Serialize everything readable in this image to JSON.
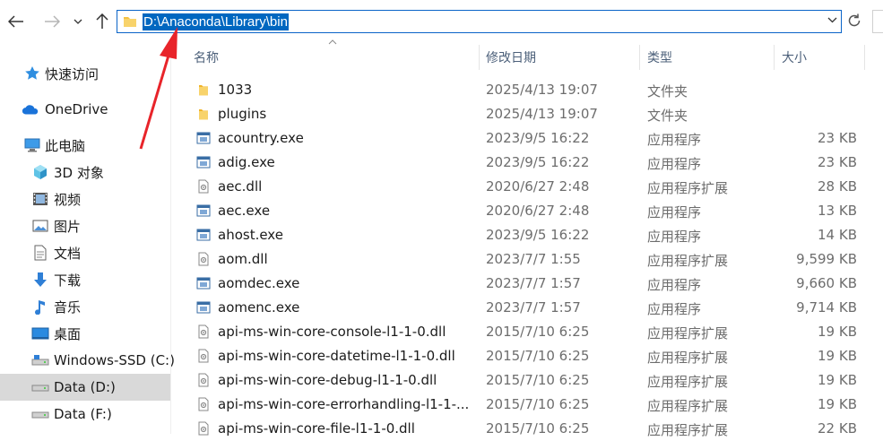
{
  "address": {
    "path": "D:\\Anaconda\\Library\\bin"
  },
  "columns": {
    "name": "名称",
    "date": "修改日期",
    "type": "类型",
    "size": "大小"
  },
  "sidebar": {
    "items": [
      {
        "label": "快速访问"
      },
      {
        "label": "OneDrive"
      },
      {
        "label": "此电脑"
      },
      {
        "label": "3D 对象"
      },
      {
        "label": "视频"
      },
      {
        "label": "图片"
      },
      {
        "label": "文档"
      },
      {
        "label": "下载"
      },
      {
        "label": "音乐"
      },
      {
        "label": "桌面"
      },
      {
        "label": "Windows-SSD (C:)"
      },
      {
        "label": "Data (D:)"
      },
      {
        "label": "Data (F:)"
      }
    ]
  },
  "files": [
    {
      "name": "1033",
      "date": "2025/4/13 19:07",
      "type": "文件夹",
      "size": "",
      "icon": "folder"
    },
    {
      "name": "plugins",
      "date": "2025/4/13 19:07",
      "type": "文件夹",
      "size": "",
      "icon": "folder"
    },
    {
      "name": "acountry.exe",
      "date": "2023/9/5 16:22",
      "type": "应用程序",
      "size": "23 KB",
      "icon": "exe"
    },
    {
      "name": "adig.exe",
      "date": "2023/9/5 16:22",
      "type": "应用程序",
      "size": "23 KB",
      "icon": "exe"
    },
    {
      "name": "aec.dll",
      "date": "2020/6/27 2:48",
      "type": "应用程序扩展",
      "size": "28 KB",
      "icon": "dll"
    },
    {
      "name": "aec.exe",
      "date": "2020/6/27 2:48",
      "type": "应用程序",
      "size": "13 KB",
      "icon": "exe"
    },
    {
      "name": "ahost.exe",
      "date": "2023/9/5 16:22",
      "type": "应用程序",
      "size": "14 KB",
      "icon": "exe"
    },
    {
      "name": "aom.dll",
      "date": "2023/7/7 1:55",
      "type": "应用程序扩展",
      "size": "9,599 KB",
      "icon": "dll"
    },
    {
      "name": "aomdec.exe",
      "date": "2023/7/7 1:57",
      "type": "应用程序",
      "size": "9,660 KB",
      "icon": "exe"
    },
    {
      "name": "aomenc.exe",
      "date": "2023/7/7 1:57",
      "type": "应用程序",
      "size": "9,714 KB",
      "icon": "exe"
    },
    {
      "name": "api-ms-win-core-console-l1-1-0.dll",
      "date": "2015/7/10 6:25",
      "type": "应用程序扩展",
      "size": "19 KB",
      "icon": "dll"
    },
    {
      "name": "api-ms-win-core-datetime-l1-1-0.dll",
      "date": "2015/7/10 6:25",
      "type": "应用程序扩展",
      "size": "19 KB",
      "icon": "dll"
    },
    {
      "name": "api-ms-win-core-debug-l1-1-0.dll",
      "date": "2015/7/10 6:25",
      "type": "应用程序扩展",
      "size": "19 KB",
      "icon": "dll"
    },
    {
      "name": "api-ms-win-core-errorhandling-l1-1-...",
      "date": "2015/7/10 6:25",
      "type": "应用程序扩展",
      "size": "19 KB",
      "icon": "dll"
    },
    {
      "name": "api-ms-win-core-file-l1-1-0.dll",
      "date": "2015/7/10 6:25",
      "type": "应用程序扩展",
      "size": "22 KB",
      "icon": "dll"
    }
  ],
  "colors": {
    "selection": "#0067c0",
    "annotation_arrow": "#e8242a",
    "folder": "#f5c242"
  }
}
